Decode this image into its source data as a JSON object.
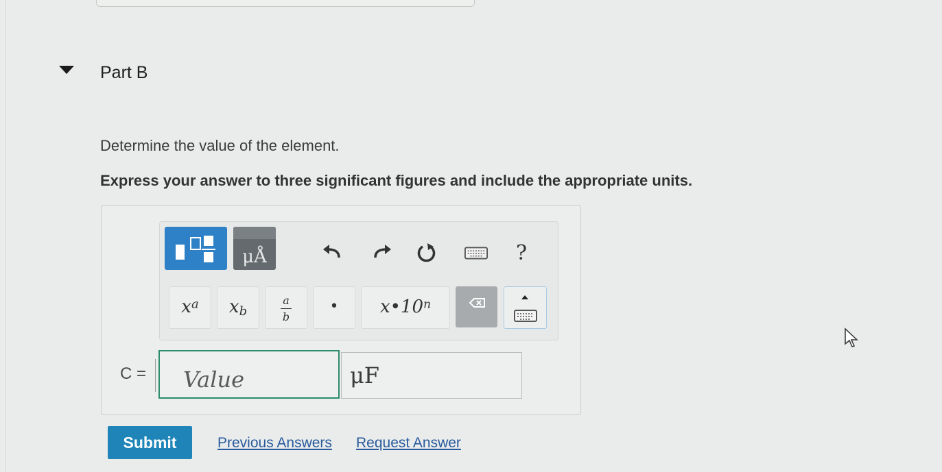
{
  "part": {
    "title": "Part B"
  },
  "question": {
    "prompt": "Determine the value of the element.",
    "instruction": "Express your answer to three significant figures and include the appropriate units."
  },
  "toolbar": {
    "units_label": "μÅ",
    "help_label": "?"
  },
  "keys": {
    "superscript": "x",
    "superscript_exp": "a",
    "subscript": "x",
    "subscript_sub": "b",
    "fraction_num": "a",
    "fraction_den": "b",
    "dot": "•",
    "sci_notation": "x•10",
    "sci_exp": "n"
  },
  "answer": {
    "variable_label": "C =",
    "value_placeholder": "Value",
    "units_value": "μF"
  },
  "actions": {
    "submit_label": "Submit",
    "previous_answers_label": "Previous Answers",
    "request_answer_label": "Request Answer"
  },
  "colors": {
    "accent": "#2e80c7",
    "submit": "#1f85b9",
    "input_border": "#2d8b6e",
    "link": "#2a5a9e"
  }
}
